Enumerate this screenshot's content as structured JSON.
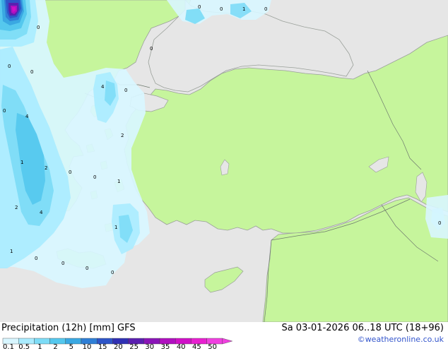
{
  "title": "Precipitation (12h) [mm] GFS",
  "datetime": "Sa 03-01-2026 06..18 UTC (18+96)",
  "credit": "©weatheronline.co.uk",
  "legend": {
    "labels": [
      "0.1",
      "0.5",
      "1",
      "2",
      "5",
      "10",
      "15",
      "20",
      "25",
      "30",
      "35",
      "40",
      "45",
      "50"
    ],
    "colors": [
      "#d8f6ff",
      "#aaecff",
      "#7ddcf7",
      "#55c8ee",
      "#3aa8e2",
      "#2f7fd6",
      "#2e55c8",
      "#3030b4",
      "#5a1fb0",
      "#8a14b8",
      "#b010c0",
      "#d010c8",
      "#e820d0",
      "#f040e0"
    ]
  },
  "colors": {
    "land": "#c6f59c",
    "sea": "#e6e6e6",
    "coast": "#9aa09a",
    "border": "#6e7a6e"
  },
  "map_labels": [
    "0",
    "0",
    "1",
    "0",
    "0",
    "0",
    "0",
    "0",
    "4",
    "0",
    "4",
    "0",
    "2",
    "1",
    "2",
    "0",
    "0",
    "1",
    "2",
    "4",
    "1",
    "1",
    "0",
    "0",
    "0",
    "0",
    "0"
  ]
}
